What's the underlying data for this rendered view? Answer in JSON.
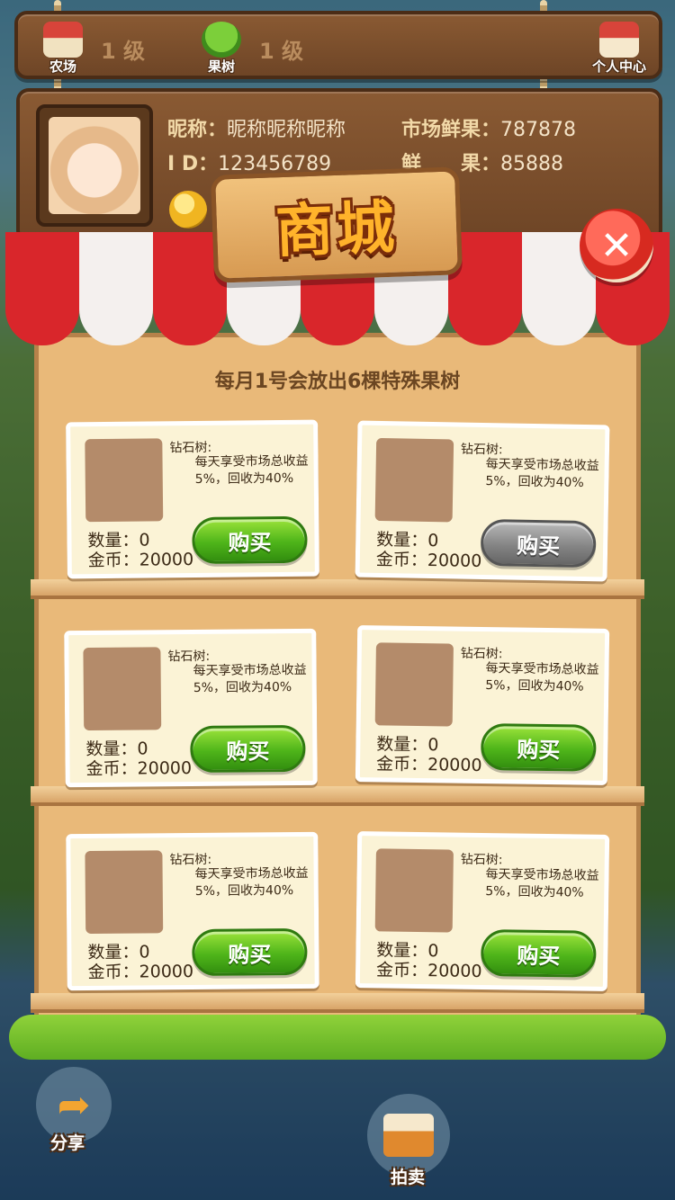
{
  "top_bar": {
    "farm_label": "农场",
    "farm_level": "1 级",
    "tree_label": "果树",
    "tree_level": "1 级",
    "profile_center_label": "个人中心"
  },
  "profile": {
    "nickname_label": "昵称：",
    "nickname": "昵称昵称昵称",
    "id_label": "I D：",
    "id": "123456789",
    "market_fruit_label": "市场鲜果：",
    "market_fruit": "787878",
    "fruit_label": "鲜　　果：",
    "fruit": "85888"
  },
  "shop": {
    "title": "商城",
    "notice": "每月1号会放出6棵特殊果树",
    "items": [
      {
        "name": "钻石树:",
        "desc": "每天享受市场总收益5%，回收为40%",
        "qty": "数量：0",
        "price": "金币：20000",
        "button": "购买",
        "enabled": true
      },
      {
        "name": "钻石树:",
        "desc": "每天享受市场总收益5%，回收为40%",
        "qty": "数量：0",
        "price": "金币：20000",
        "button": "购买",
        "enabled": false
      },
      {
        "name": "钻石树:",
        "desc": "每天享受市场总收益5%，回收为40%",
        "qty": "数量：0",
        "price": "金币：20000",
        "button": "购买",
        "enabled": true
      },
      {
        "name": "钻石树:",
        "desc": "每天享受市场总收益5%，回收为40%",
        "qty": "数量：0",
        "price": "金币：20000",
        "button": "购买",
        "enabled": true
      },
      {
        "name": "钻石树:",
        "desc": "每天享受市场总收益5%，回收为40%",
        "qty": "数量：0",
        "price": "金币：20000",
        "button": "购买",
        "enabled": true
      },
      {
        "name": "钻石树:",
        "desc": "每天享受市场总收益5%，回收为40%",
        "qty": "数量：0",
        "price": "金币：20000",
        "button": "购买",
        "enabled": true
      }
    ]
  },
  "bottom": {
    "share_label": "分享",
    "auction_label": "拍卖"
  },
  "colors": {
    "buy_green": "#4fb51a",
    "buy_disabled": "#858585",
    "panel": "#e9b979",
    "awning_red": "#d9262b"
  }
}
